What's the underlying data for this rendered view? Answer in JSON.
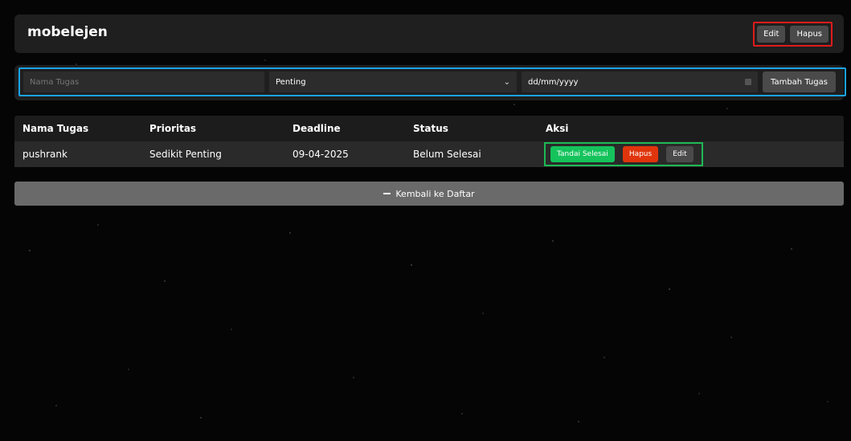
{
  "header": {
    "title": "mobelejen",
    "edit_label": "Edit",
    "delete_label": "Hapus"
  },
  "form": {
    "name_placeholder": "Nama Tugas",
    "priority_selected": "Penting",
    "date_placeholder": "dd/mm/yyyy",
    "add_label": "Tambah Tugas"
  },
  "table": {
    "headers": [
      "Nama Tugas",
      "Prioritas",
      "Deadline",
      "Status",
      "Aksi"
    ],
    "rows": [
      {
        "name": "pushrank",
        "priority": "Sedikit Penting",
        "deadline": "09-04-2025",
        "status": "Belum Selesai",
        "actions": {
          "done_label": "Tandai Selesai",
          "delete_label": "Hapus",
          "edit_label": "Edit"
        }
      }
    ]
  },
  "back": {
    "label": "Kembali ke Daftar"
  },
  "icons": {
    "select": "chevron-down-icon",
    "date": "calendar-icon",
    "back": "minus-icon"
  },
  "colors": {
    "green": "#15c35c",
    "red": "#e0350c",
    "highlight_red": "#e01b1b",
    "highlight_blue": "#1aa3e8",
    "highlight_green": "#1db954"
  }
}
